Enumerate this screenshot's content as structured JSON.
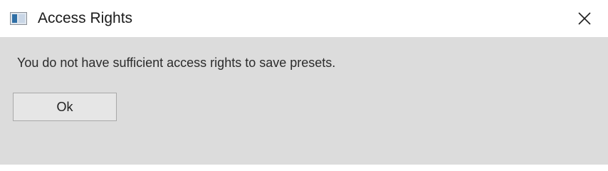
{
  "window": {
    "title": "Access Rights",
    "app_icon": "application-window-icon",
    "close_icon": "close-icon"
  },
  "dialog": {
    "message": "You do not have sufficient access rights to save presets.",
    "ok_label": "Ok"
  },
  "colors": {
    "titlebar_bg": "#ffffff",
    "content_bg": "#dcdcdc",
    "button_bg": "#e6e6e6",
    "button_border": "#a9a9a9",
    "text": "#2b2b2b"
  }
}
